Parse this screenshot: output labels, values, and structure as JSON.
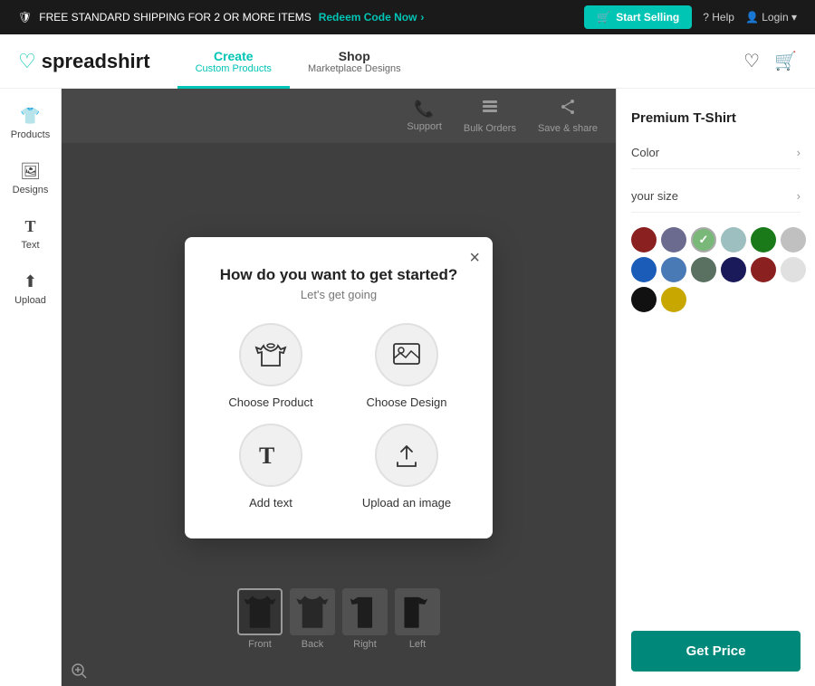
{
  "banner": {
    "left_text": "FREE STANDARD SHIPPING FOR 2 OR MORE ITEMS",
    "right_text": "Redeem Code Now",
    "arrow": "›",
    "start_selling": "Start Selling",
    "help": "Help",
    "login": "Login"
  },
  "header": {
    "logo": "spreadshirt",
    "nav": [
      {
        "id": "create",
        "label": "Create",
        "sub": "Custom Products",
        "active": true
      },
      {
        "id": "shop",
        "label": "Shop",
        "sub": "Marketplace Designs",
        "active": false
      }
    ]
  },
  "sidebar": {
    "items": [
      {
        "id": "products",
        "icon": "👕",
        "label": "Products"
      },
      {
        "id": "designs",
        "icon": "🖼",
        "label": "Designs"
      },
      {
        "id": "text",
        "icon": "T",
        "label": "Text"
      },
      {
        "id": "upload",
        "icon": "⬆",
        "label": "Upload"
      }
    ]
  },
  "canvas": {
    "toolbar": [
      {
        "id": "support",
        "icon": "📞",
        "label": "Support"
      },
      {
        "id": "bulk-orders",
        "icon": "🗂",
        "label": "Bulk Orders"
      },
      {
        "id": "save-share",
        "icon": "↗",
        "label": "Save & share"
      }
    ],
    "views": [
      {
        "id": "front",
        "label": "Front",
        "active": true
      },
      {
        "id": "back",
        "label": "Back",
        "active": false
      },
      {
        "id": "right",
        "label": "Right",
        "active": false
      },
      {
        "id": "left",
        "label": "Left",
        "active": false
      }
    ]
  },
  "right_panel": {
    "product_title": "Premium T-Shirt",
    "color_label": "Color",
    "size_label": "your size",
    "get_price": "Get Price",
    "colors": [
      {
        "hex": "#8B2020",
        "selected": false
      },
      {
        "hex": "#6b6b8f",
        "selected": false
      },
      {
        "hex": "#7ab87a",
        "selected": true
      },
      {
        "hex": "#9ebfbf",
        "selected": false
      },
      {
        "hex": "#1a7a1a",
        "selected": false
      },
      {
        "hex": "#c0c0c0",
        "selected": false
      },
      {
        "hex": "#1a5cb8",
        "selected": false
      },
      {
        "hex": "#4a7ab5",
        "selected": false
      },
      {
        "hex": "#5a7060",
        "selected": false
      },
      {
        "hex": "#1a1a5a",
        "selected": false
      },
      {
        "hex": "#8B2020",
        "selected": false
      },
      {
        "hex": "#e0e0e0",
        "selected": false
      },
      {
        "hex": "#111111",
        "selected": false
      },
      {
        "hex": "#c8a800",
        "selected": false
      }
    ]
  },
  "modal": {
    "title": "How do you want to get started?",
    "subtitle": "Let's get going",
    "close_label": "×",
    "options": [
      {
        "id": "choose-product",
        "icon": "👕",
        "label": "Choose Product"
      },
      {
        "id": "choose-design",
        "icon": "🖼",
        "label": "Choose Design"
      },
      {
        "id": "add-text",
        "icon": "T",
        "label": "Add text"
      },
      {
        "id": "upload-image",
        "icon": "⬆",
        "label": "Upload an image"
      }
    ]
  }
}
